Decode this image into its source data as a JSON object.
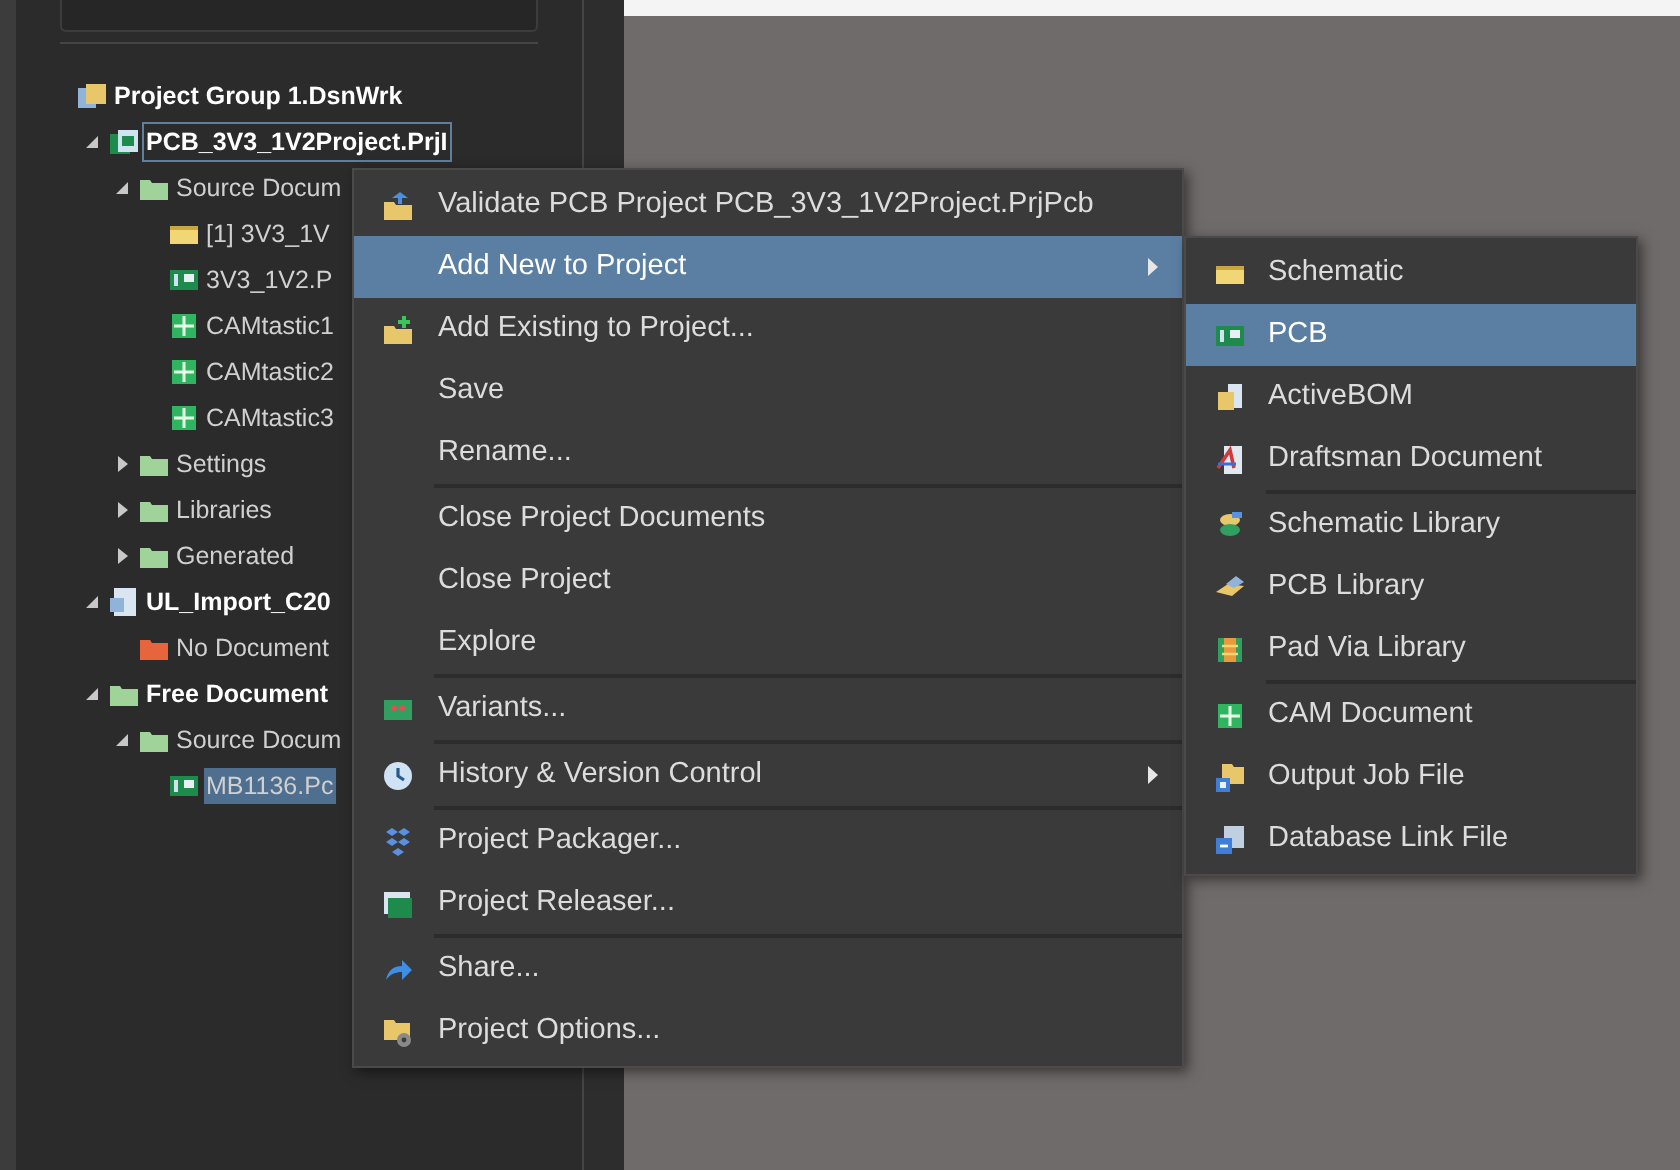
{
  "tree": [
    {
      "label": "Project Group 1.DsnWrk",
      "kind": "group",
      "bold": true,
      "children": [
        {
          "label": "PCB_3V3_1V2Project.PrjI",
          "kind": "project",
          "bold": true,
          "expanded": true,
          "focused": true,
          "children": [
            {
              "label": "Source Docum",
              "kind": "folder",
              "expanded": true,
              "children": [
                {
                  "label": "[1] 3V3_1V",
                  "kind": "schematic"
                },
                {
                  "label": "3V3_1V2.P",
                  "kind": "pcb"
                },
                {
                  "label": "CAMtastic1",
                  "kind": "cam"
                },
                {
                  "label": "CAMtastic2",
                  "kind": "cam"
                },
                {
                  "label": "CAMtastic3",
                  "kind": "cam"
                }
              ]
            },
            {
              "label": "Settings",
              "kind": "folder",
              "expanded": false
            },
            {
              "label": "Libraries",
              "kind": "folder",
              "expanded": false
            },
            {
              "label": "Generated",
              "kind": "folder",
              "expanded": false
            }
          ]
        },
        {
          "label": "UL_Import_C20",
          "kind": "project_doc",
          "bold": true,
          "expanded": true,
          "children": [
            {
              "label": "No Document",
              "kind": "folder_orange"
            }
          ]
        },
        {
          "label": "Free Document",
          "kind": "folder",
          "bold": true,
          "expanded": true,
          "children": [
            {
              "label": "Source Docum",
              "kind": "folder",
              "expanded": true,
              "children": [
                {
                  "label": "MB1136.Pc",
                  "kind": "pcb",
                  "selected": true
                }
              ]
            }
          ]
        }
      ]
    }
  ],
  "context_menu": {
    "groups": [
      [
        {
          "label": "Validate PCB Project PCB_3V3_1V2Project.PrjPcb",
          "kind": "validate",
          "selected": false,
          "submenu": false
        },
        {
          "label": "Add New to Project",
          "selected": true,
          "submenu": true
        },
        {
          "label": "Add Existing to Project...",
          "kind": "add_existing",
          "selected": false,
          "submenu": false
        },
        {
          "label": "Save",
          "selected": false,
          "submenu": false
        },
        {
          "label": "Rename...",
          "selected": false,
          "submenu": false
        }
      ],
      [
        {
          "label": "Close Project Documents",
          "selected": false,
          "submenu": false
        },
        {
          "label": "Close Project",
          "selected": false,
          "submenu": false
        },
        {
          "label": "Explore",
          "selected": false,
          "submenu": false
        }
      ],
      [
        {
          "label": "Variants...",
          "kind": "variants",
          "selected": false,
          "submenu": false
        }
      ],
      [
        {
          "label": "History & Version Control",
          "kind": "clock",
          "selected": false,
          "submenu": true
        }
      ],
      [
        {
          "label": "Project Packager...",
          "kind": "packager",
          "selected": false,
          "submenu": false
        },
        {
          "label": "Project Releaser...",
          "kind": "releaser",
          "selected": false,
          "submenu": false
        }
      ],
      [
        {
          "label": "Share...",
          "kind": "share",
          "selected": false,
          "submenu": false
        },
        {
          "label": "Project Options...",
          "kind": "options",
          "selected": false,
          "submenu": false
        }
      ]
    ]
  },
  "submenu": {
    "groups": [
      [
        {
          "label": "Schematic",
          "kind": "schematic",
          "selected": false
        },
        {
          "label": "PCB",
          "kind": "pcb",
          "selected": true
        },
        {
          "label": "ActiveBOM",
          "kind": "bom",
          "selected": false
        },
        {
          "label": "Draftsman Document",
          "kind": "draftsman",
          "selected": false
        }
      ],
      [
        {
          "label": "Schematic Library",
          "kind": "schlib",
          "selected": false
        },
        {
          "label": "PCB Library",
          "kind": "pcblib",
          "selected": false
        },
        {
          "label": "Pad Via Library",
          "kind": "padvia",
          "selected": false
        }
      ],
      [
        {
          "label": "CAM Document",
          "kind": "cam",
          "selected": false
        },
        {
          "label": "Output Job File",
          "kind": "outjob",
          "selected": false
        },
        {
          "label": "Database Link File",
          "kind": "dblink",
          "selected": false
        }
      ]
    ]
  }
}
